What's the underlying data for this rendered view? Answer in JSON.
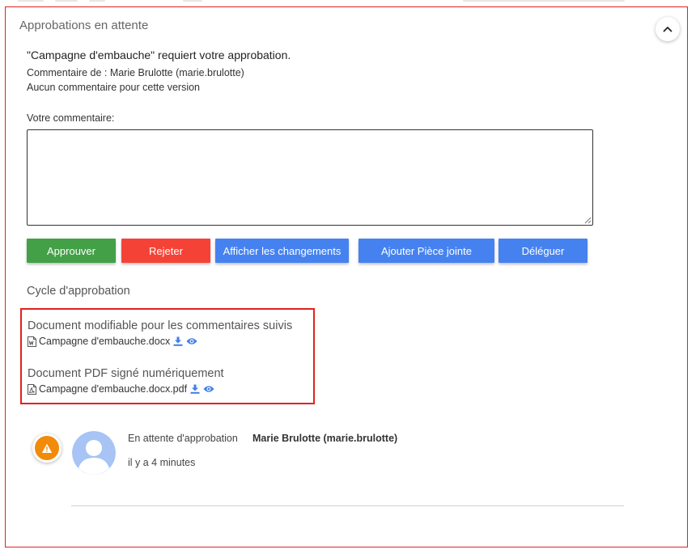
{
  "panel": {
    "title": "Approbations en attente",
    "request_line": "\"Campagne d'embauche\" requiert votre approbation.",
    "author_line": "Commentaire de : Marie Brulotte (marie.brulotte)",
    "no_comment_line": "Aucun commentaire pour cette version"
  },
  "comment": {
    "label": "Votre commentaire:",
    "value": "",
    "placeholder": ""
  },
  "actions": {
    "approve": "Approuver",
    "reject": "Rejeter",
    "show_changes": "Afficher les changements",
    "add_attachment": "Ajouter Pièce jointe",
    "delegate": "Déléguer"
  },
  "cycle": {
    "title": "Cycle d'approbation",
    "documents": [
      {
        "title": "Document modifiable pour les commentaires suivis",
        "filename": "Campagne d'embauche.docx",
        "icon": "word-file-icon"
      },
      {
        "title": "Document PDF signé numériquement",
        "filename": "Campagne d'embauche.docx.pdf",
        "icon": "pdf-file-icon"
      }
    ]
  },
  "timeline": {
    "status": "En attente d'approbation",
    "user": "Marie Brulotte (marie.brulotte)",
    "time": "il y a 4 minutes",
    "status_icon": "warning-icon"
  },
  "colors": {
    "approve": "#43a047",
    "reject": "#f44336",
    "primary": "#4682ef",
    "highlight_border": "#e0221f",
    "warning": "#f28a0a",
    "avatar": "#a8c4f5"
  }
}
